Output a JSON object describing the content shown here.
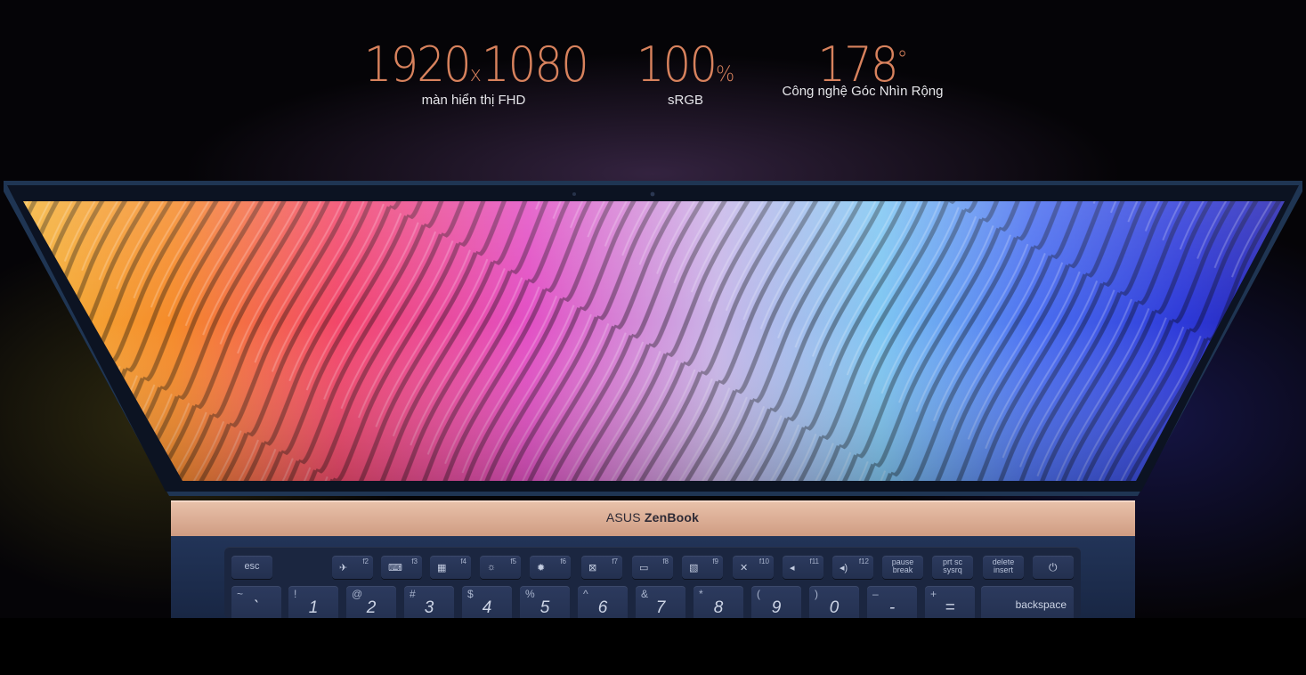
{
  "specs": {
    "resolution": {
      "value_a": "1920",
      "separator": "x",
      "value_b": "1080",
      "caption": "màn hiển thị FHD"
    },
    "color": {
      "value": "100",
      "unit": "%",
      "caption": "sRGB"
    },
    "angle": {
      "value": "178",
      "unit": "°",
      "caption": "Công nghệ Góc Nhìn Rộng"
    }
  },
  "brand": {
    "maker": "ASUS",
    "model": "ZenBook"
  },
  "keyboard": {
    "fn_row": [
      {
        "label": "esc"
      },
      {
        "glyph": "✈",
        "fn": "f2"
      },
      {
        "glyph": "⌨",
        "fn": "f3"
      },
      {
        "glyph": "▦",
        "fn": "f4"
      },
      {
        "glyph": "☼",
        "fn": "f5"
      },
      {
        "glyph": "✹",
        "fn": "f6"
      },
      {
        "glyph": "⊠",
        "fn": "f7"
      },
      {
        "glyph": "▭",
        "fn": "f8"
      },
      {
        "glyph": "▧",
        "fn": "f9"
      },
      {
        "glyph": "✕",
        "fn": "f10"
      },
      {
        "glyph": "◂",
        "fn": "f11"
      },
      {
        "glyph": "◂)",
        "fn": "f12"
      },
      {
        "label": "pause",
        "label2": "break"
      },
      {
        "label": "prt sc",
        "label2": "sysrq"
      },
      {
        "label": "delete",
        "label2": "insert"
      },
      {
        "glyph": "⏻"
      }
    ],
    "num_row": [
      {
        "shift": "~",
        "main": "`"
      },
      {
        "shift": "!",
        "main": "1"
      },
      {
        "shift": "@",
        "main": "2"
      },
      {
        "shift": "#",
        "main": "3"
      },
      {
        "shift": "$",
        "main": "4"
      },
      {
        "shift": "%",
        "main": "5"
      },
      {
        "shift": "^",
        "main": "6"
      },
      {
        "shift": "&",
        "main": "7"
      },
      {
        "shift": "*",
        "main": "8"
      },
      {
        "shift": "(",
        "main": "9"
      },
      {
        "shift": ")",
        "main": "0"
      },
      {
        "shift": "–",
        "main": "-"
      },
      {
        "shift": "+",
        "main": "="
      },
      {
        "main": "backspace"
      }
    ]
  },
  "colors": {
    "spec_accent": "#d8825d",
    "caption": "#e6e6ea",
    "bezel": "#0d1626",
    "lid_edge": "#1f3553",
    "keyboard_deck": "#1c2c4c",
    "hinge_gold": "#e2b39b"
  }
}
